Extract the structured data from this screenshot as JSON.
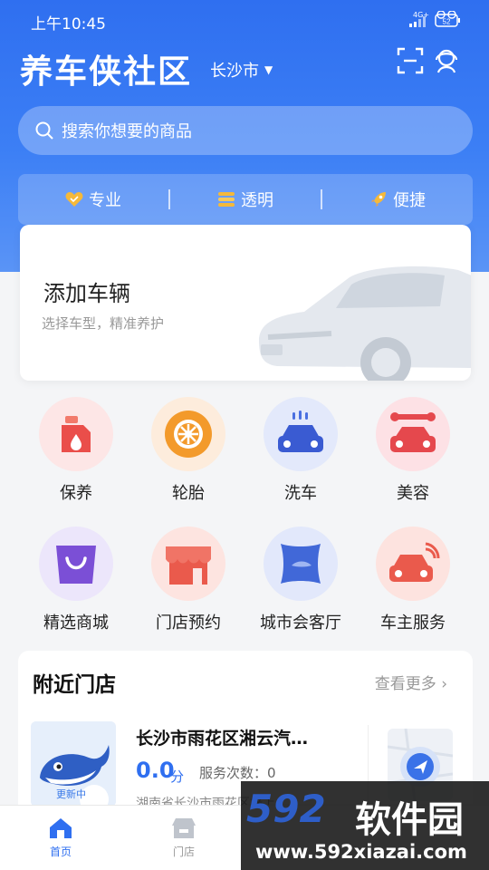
{
  "status_bar": {
    "time": "上午10:45",
    "network": "4G+",
    "battery": "52"
  },
  "header": {
    "title": "养车侠社区",
    "city": "长沙市"
  },
  "search": {
    "placeholder": "搜索你想要的商品"
  },
  "features": [
    {
      "label": "专业",
      "icon": "heart-icon"
    },
    {
      "label": "透明",
      "icon": "stack-icon"
    },
    {
      "label": "便捷",
      "icon": "rocket-icon"
    }
  ],
  "add_vehicle": {
    "title": "添加车辆",
    "subtitle": "选择车型，精准养护"
  },
  "services": [
    {
      "label": "保养",
      "icon": "oil-can-icon"
    },
    {
      "label": "轮胎",
      "icon": "tire-icon"
    },
    {
      "label": "洗车",
      "icon": "car-wash-icon"
    },
    {
      "label": "美容",
      "icon": "car-beauty-icon"
    },
    {
      "label": "精选商城",
      "icon": "shopping-bag-icon"
    },
    {
      "label": "门店预约",
      "icon": "storefront-icon"
    },
    {
      "label": "城市会客厅",
      "icon": "lounge-icon"
    },
    {
      "label": "车主服务",
      "icon": "car-service-icon"
    }
  ],
  "nearby": {
    "title": "附近门店",
    "see_more": "查看更多",
    "store": {
      "name": "长沙市雨花区湘云汽…",
      "rating": "0.0",
      "rating_unit": "分",
      "service_count": "服务次数：0",
      "address": "湖南省长沙市雨花区梓上",
      "badge": "更新中"
    }
  },
  "tabbar": [
    {
      "label": "首页",
      "active": true
    },
    {
      "label": "门店",
      "active": false
    }
  ],
  "watermark": {
    "logo": "592",
    "name": "软件园",
    "url": "www.592xiazai.com"
  },
  "colors": {
    "primary": "#2f6ff0",
    "background": "#f4f5f7"
  }
}
